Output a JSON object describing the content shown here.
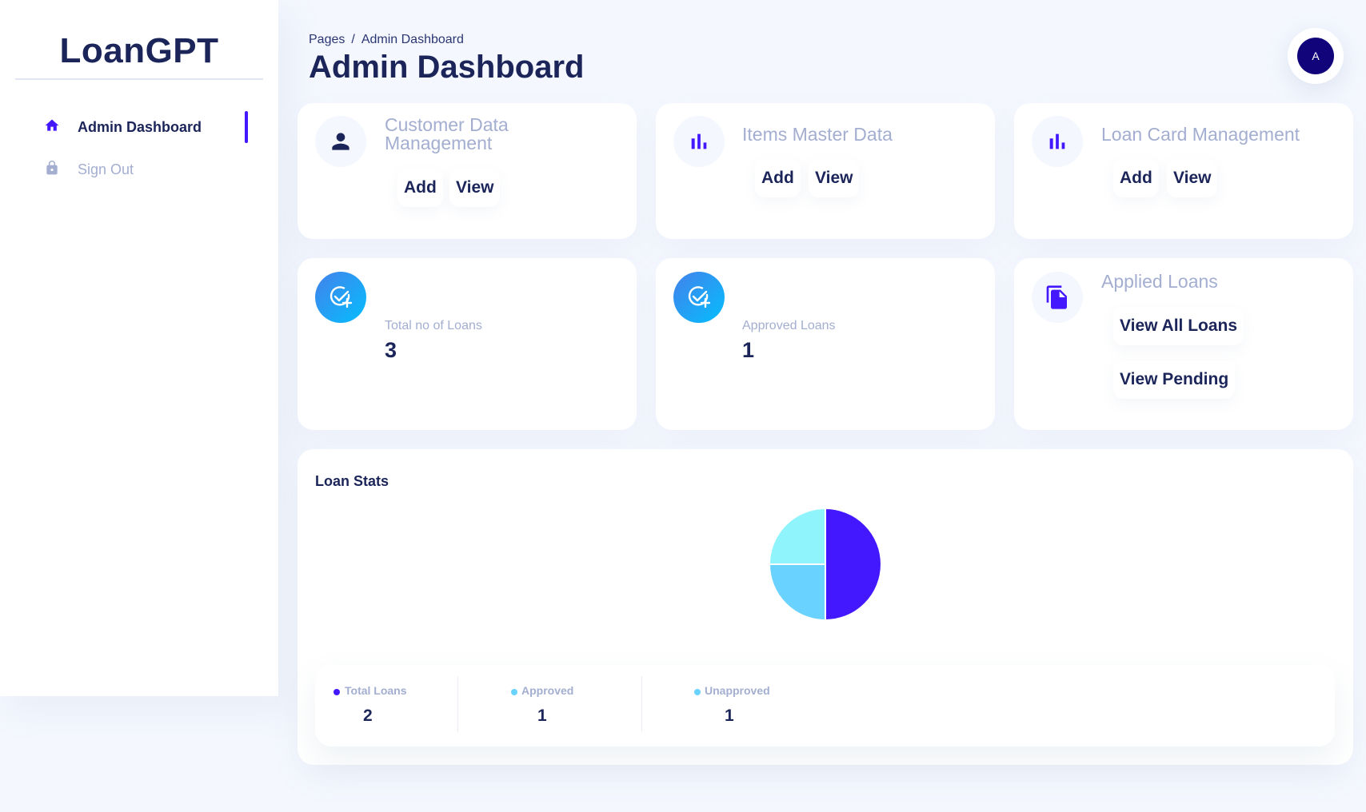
{
  "brand": {
    "name": "LoanGPT"
  },
  "sidebar": {
    "items": [
      {
        "label": "Admin Dashboard",
        "icon": "home-icon",
        "active": true
      },
      {
        "label": "Sign Out",
        "icon": "lock-icon",
        "active": false
      }
    ]
  },
  "header": {
    "breadcrumb": [
      "Pages",
      "/",
      "Admin Dashboard"
    ],
    "title": "Admin Dashboard",
    "avatar_initial": "A"
  },
  "colors": {
    "accent": "#4318ff",
    "navy": "#1b2559",
    "muted": "#a3aed0",
    "avatar_bg": "#11047a",
    "pie_total": "#4318ff",
    "pie_approved": "#6ad2ff",
    "pie_unapproved": "#90f4fd"
  },
  "cards": {
    "customer": {
      "title_line1": "Customer Data",
      "title_line2": "Management",
      "icon": "person-icon",
      "add": "Add",
      "view": "View"
    },
    "items": {
      "title": "Items Master Data",
      "icon": "bar-chart-icon",
      "add": "Add",
      "view": "View"
    },
    "loan_card": {
      "title": "Loan Card Management",
      "icon": "bar-chart-icon",
      "add": "Add",
      "view": "View"
    },
    "total_loans": {
      "label": "Total no of Loans",
      "value": "3",
      "icon": "check-add-icon"
    },
    "approved_loans": {
      "label": "Approved Loans",
      "value": "1",
      "icon": "check-add-icon"
    },
    "applied_loans": {
      "title": "Applied Loans",
      "icon": "document-icon",
      "view_all": "View All Loans",
      "view_pending": "View Pending"
    }
  },
  "loan_stats": {
    "title": "Loan Stats",
    "legend": [
      {
        "label": "Total Loans",
        "value": "2",
        "color": "#4318ff"
      },
      {
        "label": "Approved",
        "value": "1",
        "color": "#6ad2ff"
      },
      {
        "label": "Unapproved",
        "value": "1",
        "color": "#6ad2ff"
      }
    ]
  },
  "chart_data": {
    "type": "pie",
    "categories": [
      "Total Loans",
      "Approved",
      "Unapproved"
    ],
    "values": [
      2,
      1,
      1
    ],
    "colors": [
      "#4318ff",
      "#6ad2ff",
      "#90f4fd"
    ],
    "title": "Loan Stats"
  }
}
